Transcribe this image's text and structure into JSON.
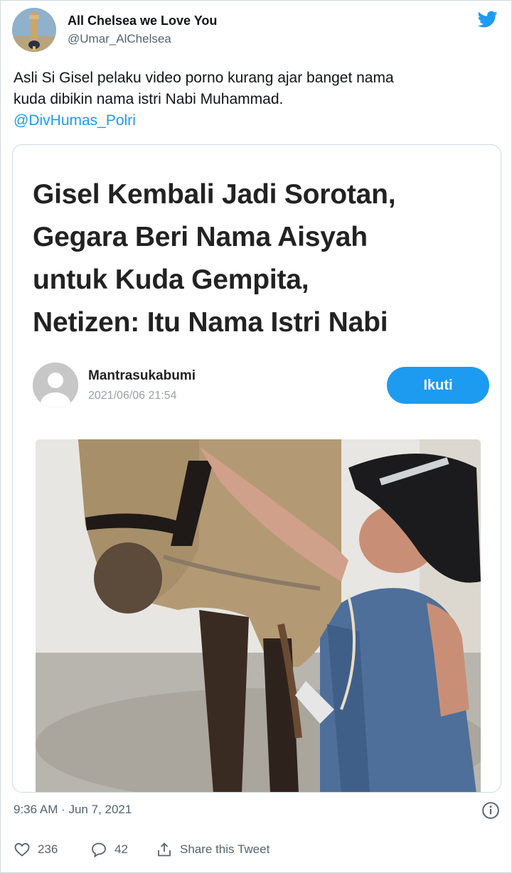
{
  "user": {
    "name": "All Chelsea we Love You",
    "handle": "@Umar_AlChelsea"
  },
  "tweet": {
    "line1": "Asli Si Gisel pelaku video porno kurang ajar banget nama",
    "line2": "kuda dibikin nama istri Nabi Muhammad.",
    "mention": "@DivHumas_Polri"
  },
  "card": {
    "headline": [
      "Gisel Kembali Jadi Sorotan,",
      "Gegara Beri Nama Aisyah",
      "untuk Kuda Gempita,",
      "Netizen: Itu Nama Istri Nabi"
    ],
    "author": "Mantrasukabumi",
    "date": "2021/06/06 21:54",
    "follow_label": "Ikuti"
  },
  "meta": {
    "timestamp": "9:36 AM · Jun 7, 2021"
  },
  "actions": {
    "likes": "236",
    "replies": "42",
    "share_label": "Share this Tweet"
  },
  "colors": {
    "twitter_blue": "#1d9bf0",
    "text_primary": "#0f1419",
    "text_secondary": "#536471"
  },
  "icons": [
    "twitter-bird-icon",
    "info-icon",
    "heart-icon",
    "reply-icon",
    "share-icon",
    "default-avatar-icon"
  ]
}
